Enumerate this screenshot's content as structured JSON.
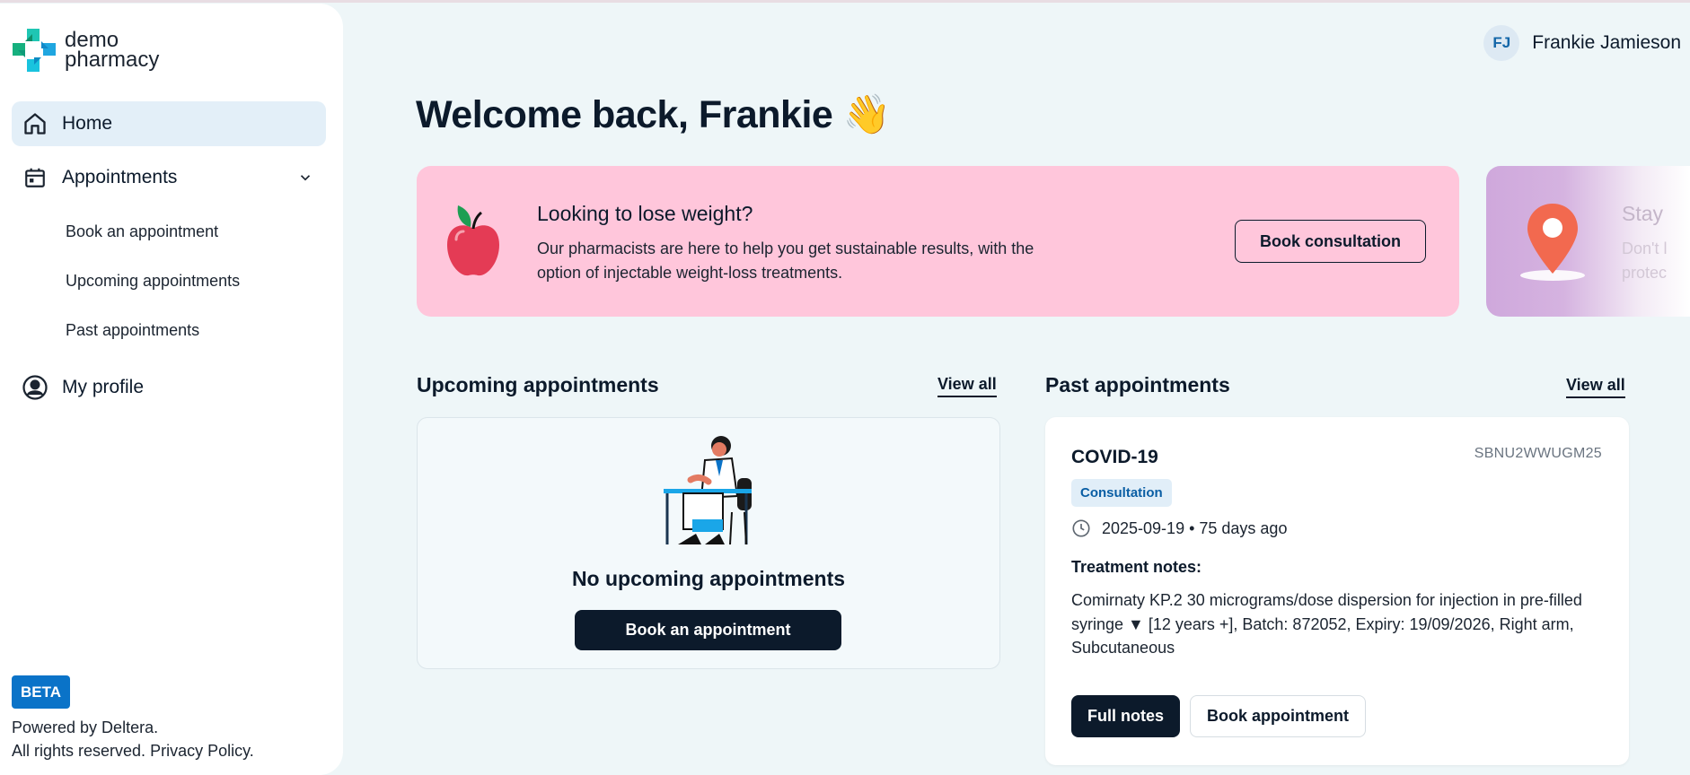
{
  "brand": {
    "line1": "demo",
    "line2": "pharmacy"
  },
  "sidebar": {
    "items": [
      {
        "label": "Home",
        "icon": "home-icon"
      },
      {
        "label": "Appointments",
        "icon": "calendar-icon"
      },
      {
        "label": "My profile",
        "icon": "user-circle-icon"
      }
    ],
    "sub_items": [
      "Book an appointment",
      "Upcoming appointments",
      "Past appointments"
    ],
    "badge": "BETA",
    "footer": {
      "powered": "Powered by Deltera.",
      "rights": "All rights reserved.",
      "privacy": "Privacy Policy."
    }
  },
  "header": {
    "initials": "FJ",
    "user_name": "Frankie Jamieson"
  },
  "welcome": "Welcome back, Frankie 👋",
  "banners": [
    {
      "title": "Looking to lose weight?",
      "text": "Our pharmacists are here to help you get sustainable results, with the option of injectable weight-loss treatments.",
      "button": "Book consultation",
      "color": "#ffc6db"
    },
    {
      "title": "Stay",
      "text_line1": "Don't l",
      "text_line2": "protec",
      "color": "#cfa8dc"
    }
  ],
  "upcoming": {
    "title": "Upcoming appointments",
    "view_all": "View all",
    "empty_title": "No upcoming appointments",
    "button": "Book an appointment"
  },
  "past": {
    "title": "Past appointments",
    "view_all": "View all",
    "card": {
      "name": "COVID-19",
      "reference": "SBNU2WWUGM25",
      "type": "Consultation",
      "date": "2025-09-19 • 75 days ago",
      "notes_label": "Treatment notes:",
      "notes": "Comirnaty KP.2 30 micrograms/dose dispersion for injection in pre-filled syringe ▼ [12 years +], Batch: 872052, Expiry: 19/09/2026, Right arm, Subcutaneous",
      "primary_button": "Full notes",
      "secondary_button": "Book appointment"
    }
  },
  "colors": {
    "accent": "#0a73c8",
    "dark": "#0c1a2b",
    "background": "#eef6f8"
  }
}
